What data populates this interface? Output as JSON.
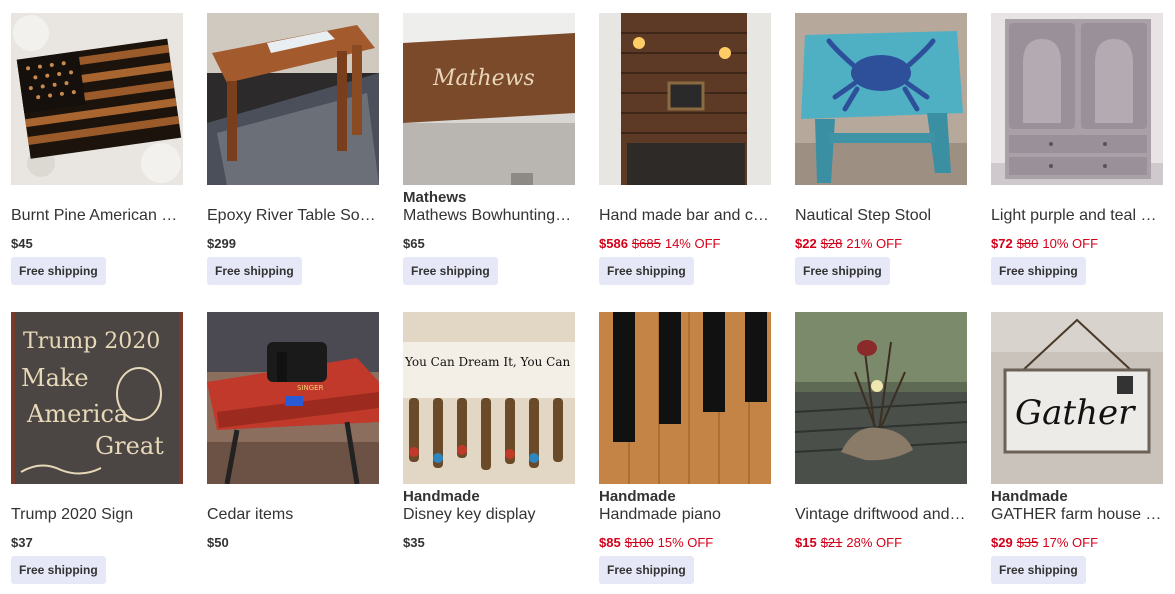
{
  "products": [
    {
      "title": "Burnt Pine American Flag",
      "price": "$45",
      "shipping": "Free shipping",
      "image": "burnt-flag"
    },
    {
      "title": "Epoxy River Table Solid Wood",
      "price": "$299",
      "shipping": "Free shipping",
      "image": "epoxy-table"
    },
    {
      "brand": "Mathews",
      "title": "Mathews Bowhunting Sign",
      "price": "$65",
      "shipping": "Free shipping",
      "image": "mathews-sign"
    },
    {
      "title": "Hand made bar and cabinet",
      "price": "$586",
      "original_price": "$685",
      "discount": "14% OFF",
      "shipping": "Free shipping",
      "image": "bar-cabinet"
    },
    {
      "title": "Nautical Step Stool",
      "price": "$22",
      "original_price": "$28",
      "discount": "21% OFF",
      "shipping": "Free shipping",
      "image": "crab-stool"
    },
    {
      "title": "Light purple and teal cabinet",
      "price": "$72",
      "original_price": "$80",
      "discount": "10% OFF",
      "shipping": "Free shipping",
      "image": "purple-cabinet"
    },
    {
      "title": "Trump 2020 Sign",
      "price": "$37",
      "shipping": "Free shipping",
      "image": "trump-sign"
    },
    {
      "title": "Cedar items",
      "price": "$50",
      "image": "cedar-table"
    },
    {
      "brand": "Handmade",
      "title": "Disney key display",
      "price": "$35",
      "image": "key-display"
    },
    {
      "brand": "Handmade",
      "title": "Handmade piano",
      "price": "$85",
      "original_price": "$100",
      "discount": "15% OFF",
      "shipping": "Free shipping",
      "image": "piano-keys"
    },
    {
      "title": "Vintage driftwood and flowers",
      "price": "$15",
      "original_price": "$21",
      "discount": "28% OFF",
      "image": "driftwood"
    },
    {
      "brand": "Handmade",
      "title": "GATHER farm house sign",
      "price": "$29",
      "original_price": "$35",
      "discount": "17% OFF",
      "shipping": "Free shipping",
      "image": "gather-sign"
    }
  ],
  "image_text": {
    "mathews": "Mathews",
    "trump_line1": "Trump 2020",
    "trump_line2": "Make",
    "trump_line3": "America",
    "trump_line4": "Great",
    "dream": "You Can Dream It, You Can",
    "gather": "Gather",
    "singer": "SINGER"
  },
  "colors": {
    "sale": "#d4001a",
    "shipping_bg": "#e6e8f7"
  }
}
